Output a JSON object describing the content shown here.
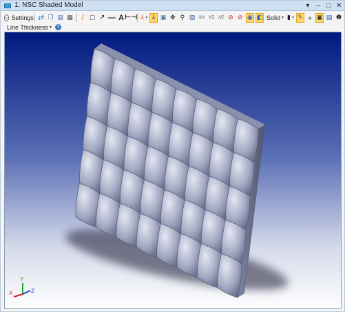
{
  "window": {
    "title": "1: NSC Shaded Model",
    "controls": [
      "▾",
      "–",
      "□",
      "✕"
    ]
  },
  "toolbar": {
    "settings_label": "Settings",
    "draw_mode_label": "Solid",
    "line_thickness_label": "Line Thickness",
    "axis_buttons": [
      "X/Y",
      "Y/Z",
      "X/Z"
    ],
    "text_tool_label": "A"
  },
  "viewport": {
    "background_top": "#00197f",
    "background_bottom": "#ffffff",
    "model_color": "#9aa0b8",
    "grid": {
      "columns": 8,
      "rows": 5
    },
    "axes": {
      "x_label": "X",
      "y_label": "Y",
      "z_label": "Z",
      "x_color": "#d42020",
      "y_color": "#20b020",
      "z_color": "#2040e0"
    }
  }
}
